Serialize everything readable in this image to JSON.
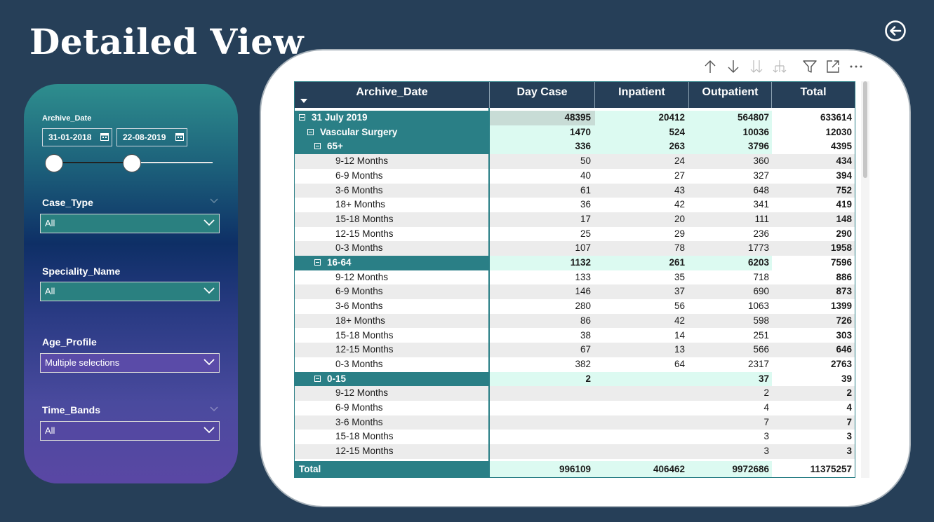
{
  "page": {
    "title": "Detailed View"
  },
  "filters": {
    "archive_date": {
      "label": "Archive_Date",
      "start": "31-01-2018",
      "end": "22-08-2019"
    },
    "case_type": {
      "label": "Case_Type",
      "value": "All"
    },
    "speciality_name": {
      "label": "Speciality_Name",
      "value": "All"
    },
    "age_profile": {
      "label": "Age_Profile",
      "value": "Multiple selections"
    },
    "time_bands": {
      "label": "Time_Bands",
      "value": "All"
    }
  },
  "toolbar": [
    "arrow-up-icon",
    "arrow-down-icon",
    "double-arrow-down-icon",
    "hierarchy-expand-icon",
    "filter-icon",
    "focus-mode-icon",
    "more-options-icon"
  ],
  "matrix": {
    "columns": [
      "Archive_Date",
      "Day Case",
      "Inpatient",
      "Outpatient",
      "Total"
    ],
    "rows": [
      {
        "label": "31 July 2019",
        "level": 0,
        "type": "group",
        "values": [
          "48395",
          "20412",
          "564807",
          "633614"
        ]
      },
      {
        "label": "Vascular Surgery",
        "level": 1,
        "type": "group",
        "values": [
          "1470",
          "524",
          "10036",
          "12030"
        ]
      },
      {
        "label": "65+",
        "level": 2,
        "type": "group",
        "values": [
          "336",
          "263",
          "3796",
          "4395"
        ]
      },
      {
        "label": "9-12 Months",
        "level": 3,
        "type": "leaf",
        "values": [
          "50",
          "24",
          "360",
          "434"
        ]
      },
      {
        "label": "6-9 Months",
        "level": 3,
        "type": "leaf",
        "values": [
          "40",
          "27",
          "327",
          "394"
        ]
      },
      {
        "label": "3-6 Months",
        "level": 3,
        "type": "leaf",
        "values": [
          "61",
          "43",
          "648",
          "752"
        ]
      },
      {
        "label": "18+ Months",
        "level": 3,
        "type": "leaf",
        "values": [
          "36",
          "42",
          "341",
          "419"
        ]
      },
      {
        "label": "15-18 Months",
        "level": 3,
        "type": "leaf",
        "values": [
          "17",
          "20",
          "111",
          "148"
        ]
      },
      {
        "label": "12-15 Months",
        "level": 3,
        "type": "leaf",
        "values": [
          "25",
          "29",
          "236",
          "290"
        ]
      },
      {
        "label": "0-3 Months",
        "level": 3,
        "type": "leaf",
        "values": [
          "107",
          "78",
          "1773",
          "1958"
        ]
      },
      {
        "label": "16-64",
        "level": 2,
        "type": "group",
        "values": [
          "1132",
          "261",
          "6203",
          "7596"
        ]
      },
      {
        "label": "9-12 Months",
        "level": 3,
        "type": "leaf",
        "values": [
          "133",
          "35",
          "718",
          "886"
        ]
      },
      {
        "label": "6-9 Months",
        "level": 3,
        "type": "leaf",
        "values": [
          "146",
          "37",
          "690",
          "873"
        ]
      },
      {
        "label": "3-6 Months",
        "level": 3,
        "type": "leaf",
        "values": [
          "280",
          "56",
          "1063",
          "1399"
        ]
      },
      {
        "label": "18+ Months",
        "level": 3,
        "type": "leaf",
        "values": [
          "86",
          "42",
          "598",
          "726"
        ]
      },
      {
        "label": "15-18 Months",
        "level": 3,
        "type": "leaf",
        "values": [
          "38",
          "14",
          "251",
          "303"
        ]
      },
      {
        "label": "12-15 Months",
        "level": 3,
        "type": "leaf",
        "values": [
          "67",
          "13",
          "566",
          "646"
        ]
      },
      {
        "label": "0-3 Months",
        "level": 3,
        "type": "leaf",
        "values": [
          "382",
          "64",
          "2317",
          "2763"
        ]
      },
      {
        "label": "0-15",
        "level": 2,
        "type": "group",
        "values": [
          "2",
          "",
          "37",
          "39"
        ]
      },
      {
        "label": "9-12 Months",
        "level": 3,
        "type": "leaf",
        "values": [
          "",
          "",
          "2",
          "2"
        ]
      },
      {
        "label": "6-9 Months",
        "level": 3,
        "type": "leaf",
        "values": [
          "",
          "",
          "4",
          "4"
        ]
      },
      {
        "label": "3-6 Months",
        "level": 3,
        "type": "leaf",
        "values": [
          "",
          "",
          "7",
          "7"
        ]
      },
      {
        "label": "15-18 Months",
        "level": 3,
        "type": "leaf",
        "values": [
          "",
          "",
          "3",
          "3"
        ]
      },
      {
        "label": "12-15 Months",
        "level": 3,
        "type": "leaf",
        "values": [
          "",
          "",
          "3",
          "3"
        ]
      }
    ],
    "total": {
      "label": "Total",
      "values": [
        "996109",
        "406462",
        "9972686",
        "11375257"
      ]
    }
  },
  "colors": {
    "background": "#263f58",
    "header": "#263f58",
    "group_row": "#2a7f86",
    "group_value_bg": "#dcfaf1",
    "highlight_cell": "#c8dcd6",
    "leaf_row_alt": "#ececec"
  }
}
